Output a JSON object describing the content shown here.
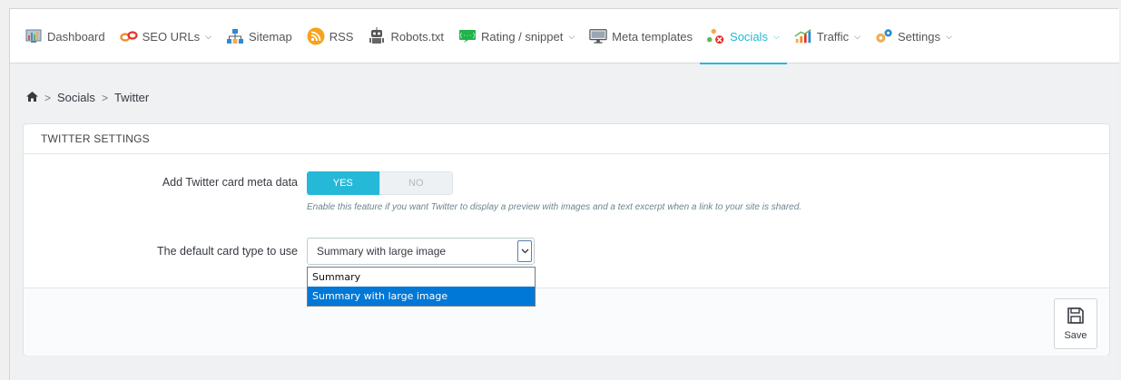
{
  "nav": {
    "items": [
      {
        "label": "Dashboard",
        "icon": "dashboard-icon",
        "dropdown": false
      },
      {
        "label": "SEO URLs",
        "icon": "link-icon",
        "dropdown": true
      },
      {
        "label": "Sitemap",
        "icon": "sitemap-icon",
        "dropdown": false
      },
      {
        "label": "RSS",
        "icon": "rss-icon",
        "dropdown": false
      },
      {
        "label": "Robots.txt",
        "icon": "robot-icon",
        "dropdown": false
      },
      {
        "label": "Rating / snippet",
        "icon": "snippet-icon",
        "dropdown": true
      },
      {
        "label": "Meta templates",
        "icon": "monitor-icon",
        "dropdown": false
      },
      {
        "label": "Socials",
        "icon": "socials-icon",
        "dropdown": true,
        "active": true
      },
      {
        "label": "Traffic",
        "icon": "traffic-icon",
        "dropdown": true
      },
      {
        "label": "Settings",
        "icon": "settings-icon",
        "dropdown": true
      }
    ]
  },
  "breadcrumb": {
    "home_icon": "home-icon",
    "items": [
      "Socials",
      "Twitter"
    ]
  },
  "panel": {
    "title": "TWITTER SETTINGS",
    "card_meta": {
      "label": "Add Twitter card meta data",
      "yes": "YES",
      "no": "NO",
      "value": "YES",
      "help": "Enable this feature if you want Twitter to display a preview with images and a text excerpt when a link to your site is shared."
    },
    "card_type": {
      "label": "The default card type to use",
      "selected": "Summary with large image",
      "options": [
        "Summary",
        "Summary with large image"
      ]
    },
    "save_label": "Save"
  },
  "colors": {
    "accent": "#25b9d7",
    "dropdown_selection": "#0078d7"
  }
}
